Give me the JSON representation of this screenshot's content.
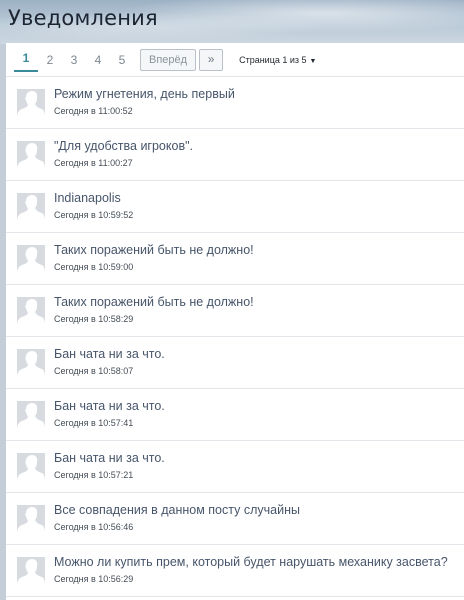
{
  "header": {
    "title": "Уведомления"
  },
  "pagination": {
    "pages": [
      "1",
      "2",
      "3",
      "4",
      "5"
    ],
    "active": "1",
    "next_label": "Вперёд",
    "last_label": "»",
    "info": "Страница 1 из 5",
    "info_caret": "▼"
  },
  "notifications": [
    {
      "title": "Режим угнетения, день первый",
      "time": "Сегодня в 11:00:52"
    },
    {
      "title": "\"Для удобства игроков\".",
      "time": "Сегодня в 11:00:27"
    },
    {
      "title": "Indianapolis",
      "time": "Сегодня в 10:59:52"
    },
    {
      "title": "Таких поражений быть не должно!",
      "time": "Сегодня в 10:59:00"
    },
    {
      "title": "Таких поражений быть не должно!",
      "time": "Сегодня в 10:58:29"
    },
    {
      "title": "Бан чата ни за что.",
      "time": "Сегодня в 10:58:07"
    },
    {
      "title": "Бан чата ни за что.",
      "time": "Сегодня в 10:57:41"
    },
    {
      "title": "Бан чата ни за что.",
      "time": "Сегодня в 10:57:21"
    },
    {
      "title": "Все совпадения в данном посту случайны",
      "time": "Сегодня в 10:56:46"
    },
    {
      "title": "Можно ли купить прем, который будет нарушать механику засвета?",
      "time": "Сегодня в 10:56:29"
    }
  ],
  "colors": {
    "accent": "#3a8a9a",
    "title_text": "#47556a",
    "avatar_bg": "#d7dade",
    "avatar_silhouette": "#ffffff"
  },
  "icons": {
    "avatar": "default-user-silhouette-icon"
  }
}
